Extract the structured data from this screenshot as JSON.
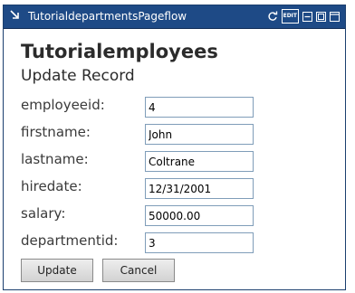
{
  "titlebar": {
    "title": "TutorialdepartmentsPageflow",
    "edit_label": "EDIT"
  },
  "page": {
    "heading": "Tutorialemployees",
    "subheading": "Update Record"
  },
  "form": {
    "fields": [
      {
        "label": "employeeid:",
        "value": "4"
      },
      {
        "label": "firstname:",
        "value": "John"
      },
      {
        "label": "lastname:",
        "value": "Coltrane"
      },
      {
        "label": "hiredate:",
        "value": "12/31/2001"
      },
      {
        "label": "salary:",
        "value": "50000.00"
      },
      {
        "label": "departmentid:",
        "value": "3"
      }
    ],
    "update_label": "Update",
    "cancel_label": "Cancel"
  }
}
